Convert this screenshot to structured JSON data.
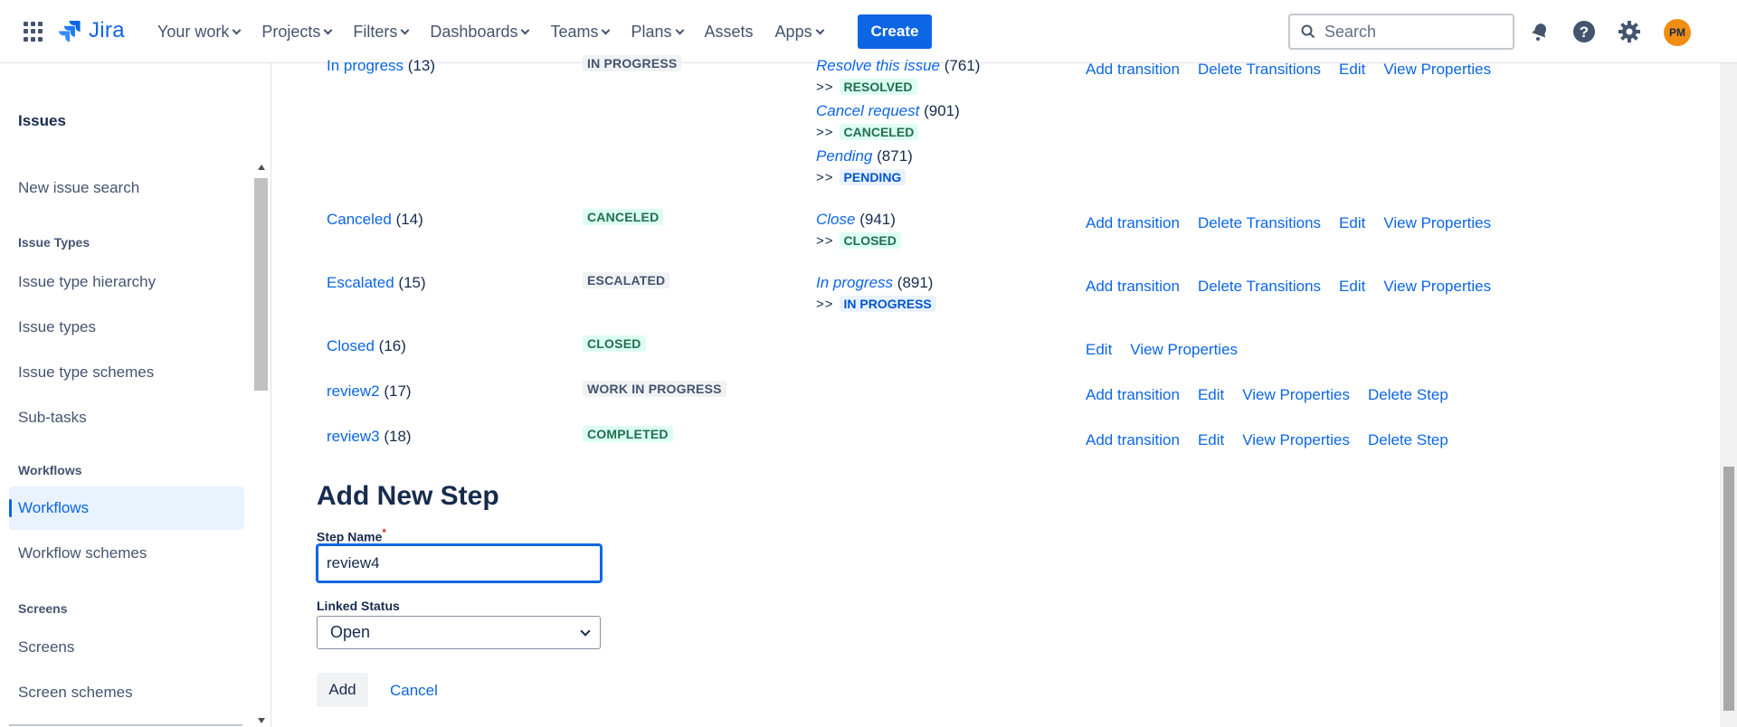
{
  "topnav": {
    "logo_text": "Jira",
    "items": [
      {
        "label": "Your work",
        "has_chevron": true
      },
      {
        "label": "Projects",
        "has_chevron": true
      },
      {
        "label": "Filters",
        "has_chevron": true
      },
      {
        "label": "Dashboards",
        "has_chevron": true
      },
      {
        "label": "Teams",
        "has_chevron": true
      },
      {
        "label": "Plans",
        "has_chevron": true
      },
      {
        "label": "Assets",
        "has_chevron": false
      },
      {
        "label": "Apps",
        "has_chevron": true
      }
    ],
    "create_label": "Create",
    "search_placeholder": "Search",
    "avatar_initials": "PM",
    "brand_color": "#0c66e4",
    "avatar_color": "#f18d13"
  },
  "sidebar": {
    "heading": "Issues",
    "new_issue_search": "New issue search",
    "section_issue_types": "Issue Types",
    "issue_type_hierarchy": "Issue type hierarchy",
    "issue_types": "Issue types",
    "issue_type_schemes": "Issue type schemes",
    "sub_tasks": "Sub-tasks",
    "section_workflows": "Workflows",
    "workflows": "Workflows",
    "workflow_schemes": "Workflow schemes",
    "section_screens": "Screens",
    "screens": "Screens",
    "screen_schemes": "Screen schemes"
  },
  "steps": [
    {
      "name": "In progress",
      "id": "(13)",
      "status": "IN PROGRESS",
      "transitions": [
        {
          "name": "Resolve this issue",
          "id": "(761)",
          "target": "RESOLVED"
        },
        {
          "name": "Cancel request",
          "id": "(901)",
          "target": "CANCELED"
        },
        {
          "name": "Pending",
          "id": "(871)",
          "target": "PENDING"
        }
      ],
      "ops": [
        "Add transition",
        "Delete Transitions",
        "Edit",
        "View Properties"
      ]
    },
    {
      "name": "Canceled",
      "id": "(14)",
      "status": "CANCELED",
      "transitions": [
        {
          "name": "Close",
          "id": "(941)",
          "target": "CLOSED"
        }
      ],
      "ops": [
        "Add transition",
        "Delete Transitions",
        "Edit",
        "View Properties"
      ]
    },
    {
      "name": "Escalated",
      "id": "(15)",
      "status": "ESCALATED",
      "transitions": [
        {
          "name": "In progress",
          "id": "(891)",
          "target": "IN PROGRESS"
        }
      ],
      "ops": [
        "Add transition",
        "Delete Transitions",
        "Edit",
        "View Properties"
      ]
    },
    {
      "name": "Closed",
      "id": "(16)",
      "status": "CLOSED",
      "transitions": [],
      "ops": [
        "Edit",
        "View Properties"
      ]
    },
    {
      "name": "review2",
      "id": "(17)",
      "status": "WORK IN PROGRESS",
      "transitions": [],
      "ops": [
        "Add transition",
        "Edit",
        "View Properties",
        "Delete Step"
      ]
    },
    {
      "name": "review3",
      "id": "(18)",
      "status": "COMPLETED",
      "transitions": [],
      "ops": [
        "Add transition",
        "Edit",
        "View Properties",
        "Delete Step"
      ]
    }
  ],
  "transition_arrow": ">>",
  "add_step": {
    "title": "Add New Step",
    "step_name_label": "Step Name",
    "required_marker": "*",
    "step_name_value": "review4",
    "linked_status_label": "Linked Status",
    "linked_status_value": "Open",
    "add_label": "Add",
    "cancel_label": "Cancel"
  }
}
